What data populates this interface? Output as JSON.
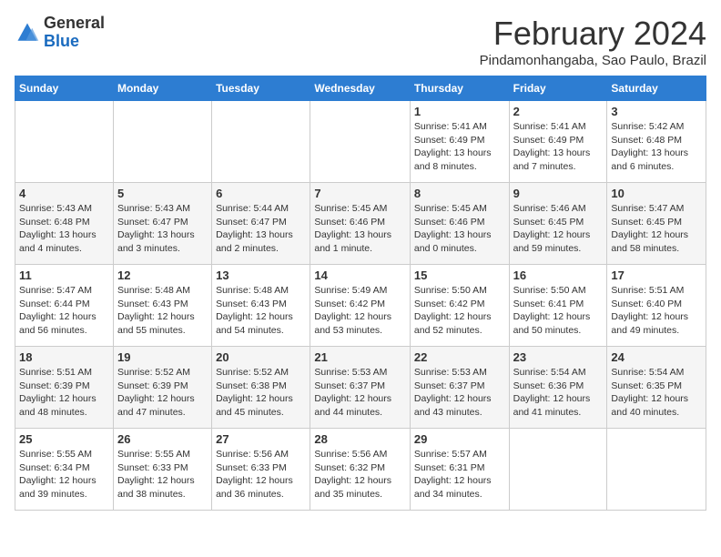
{
  "logo": {
    "general": "General",
    "blue": "Blue"
  },
  "header": {
    "month": "February 2024",
    "location": "Pindamonhangaba, Sao Paulo, Brazil"
  },
  "weekdays": [
    "Sunday",
    "Monday",
    "Tuesday",
    "Wednesday",
    "Thursday",
    "Friday",
    "Saturday"
  ],
  "weeks": [
    [
      {
        "day": "",
        "info": ""
      },
      {
        "day": "",
        "info": ""
      },
      {
        "day": "",
        "info": ""
      },
      {
        "day": "",
        "info": ""
      },
      {
        "day": "1",
        "info": "Sunrise: 5:41 AM\nSunset: 6:49 PM\nDaylight: 13 hours\nand 8 minutes."
      },
      {
        "day": "2",
        "info": "Sunrise: 5:41 AM\nSunset: 6:49 PM\nDaylight: 13 hours\nand 7 minutes."
      },
      {
        "day": "3",
        "info": "Sunrise: 5:42 AM\nSunset: 6:48 PM\nDaylight: 13 hours\nand 6 minutes."
      }
    ],
    [
      {
        "day": "4",
        "info": "Sunrise: 5:43 AM\nSunset: 6:48 PM\nDaylight: 13 hours\nand 4 minutes."
      },
      {
        "day": "5",
        "info": "Sunrise: 5:43 AM\nSunset: 6:47 PM\nDaylight: 13 hours\nand 3 minutes."
      },
      {
        "day": "6",
        "info": "Sunrise: 5:44 AM\nSunset: 6:47 PM\nDaylight: 13 hours\nand 2 minutes."
      },
      {
        "day": "7",
        "info": "Sunrise: 5:45 AM\nSunset: 6:46 PM\nDaylight: 13 hours\nand 1 minute."
      },
      {
        "day": "8",
        "info": "Sunrise: 5:45 AM\nSunset: 6:46 PM\nDaylight: 13 hours\nand 0 minutes."
      },
      {
        "day": "9",
        "info": "Sunrise: 5:46 AM\nSunset: 6:45 PM\nDaylight: 12 hours\nand 59 minutes."
      },
      {
        "day": "10",
        "info": "Sunrise: 5:47 AM\nSunset: 6:45 PM\nDaylight: 12 hours\nand 58 minutes."
      }
    ],
    [
      {
        "day": "11",
        "info": "Sunrise: 5:47 AM\nSunset: 6:44 PM\nDaylight: 12 hours\nand 56 minutes."
      },
      {
        "day": "12",
        "info": "Sunrise: 5:48 AM\nSunset: 6:43 PM\nDaylight: 12 hours\nand 55 minutes."
      },
      {
        "day": "13",
        "info": "Sunrise: 5:48 AM\nSunset: 6:43 PM\nDaylight: 12 hours\nand 54 minutes."
      },
      {
        "day": "14",
        "info": "Sunrise: 5:49 AM\nSunset: 6:42 PM\nDaylight: 12 hours\nand 53 minutes."
      },
      {
        "day": "15",
        "info": "Sunrise: 5:50 AM\nSunset: 6:42 PM\nDaylight: 12 hours\nand 52 minutes."
      },
      {
        "day": "16",
        "info": "Sunrise: 5:50 AM\nSunset: 6:41 PM\nDaylight: 12 hours\nand 50 minutes."
      },
      {
        "day": "17",
        "info": "Sunrise: 5:51 AM\nSunset: 6:40 PM\nDaylight: 12 hours\nand 49 minutes."
      }
    ],
    [
      {
        "day": "18",
        "info": "Sunrise: 5:51 AM\nSunset: 6:39 PM\nDaylight: 12 hours\nand 48 minutes."
      },
      {
        "day": "19",
        "info": "Sunrise: 5:52 AM\nSunset: 6:39 PM\nDaylight: 12 hours\nand 47 minutes."
      },
      {
        "day": "20",
        "info": "Sunrise: 5:52 AM\nSunset: 6:38 PM\nDaylight: 12 hours\nand 45 minutes."
      },
      {
        "day": "21",
        "info": "Sunrise: 5:53 AM\nSunset: 6:37 PM\nDaylight: 12 hours\nand 44 minutes."
      },
      {
        "day": "22",
        "info": "Sunrise: 5:53 AM\nSunset: 6:37 PM\nDaylight: 12 hours\nand 43 minutes."
      },
      {
        "day": "23",
        "info": "Sunrise: 5:54 AM\nSunset: 6:36 PM\nDaylight: 12 hours\nand 41 minutes."
      },
      {
        "day": "24",
        "info": "Sunrise: 5:54 AM\nSunset: 6:35 PM\nDaylight: 12 hours\nand 40 minutes."
      }
    ],
    [
      {
        "day": "25",
        "info": "Sunrise: 5:55 AM\nSunset: 6:34 PM\nDaylight: 12 hours\nand 39 minutes."
      },
      {
        "day": "26",
        "info": "Sunrise: 5:55 AM\nSunset: 6:33 PM\nDaylight: 12 hours\nand 38 minutes."
      },
      {
        "day": "27",
        "info": "Sunrise: 5:56 AM\nSunset: 6:33 PM\nDaylight: 12 hours\nand 36 minutes."
      },
      {
        "day": "28",
        "info": "Sunrise: 5:56 AM\nSunset: 6:32 PM\nDaylight: 12 hours\nand 35 minutes."
      },
      {
        "day": "29",
        "info": "Sunrise: 5:57 AM\nSunset: 6:31 PM\nDaylight: 12 hours\nand 34 minutes."
      },
      {
        "day": "",
        "info": ""
      },
      {
        "day": "",
        "info": ""
      }
    ]
  ]
}
